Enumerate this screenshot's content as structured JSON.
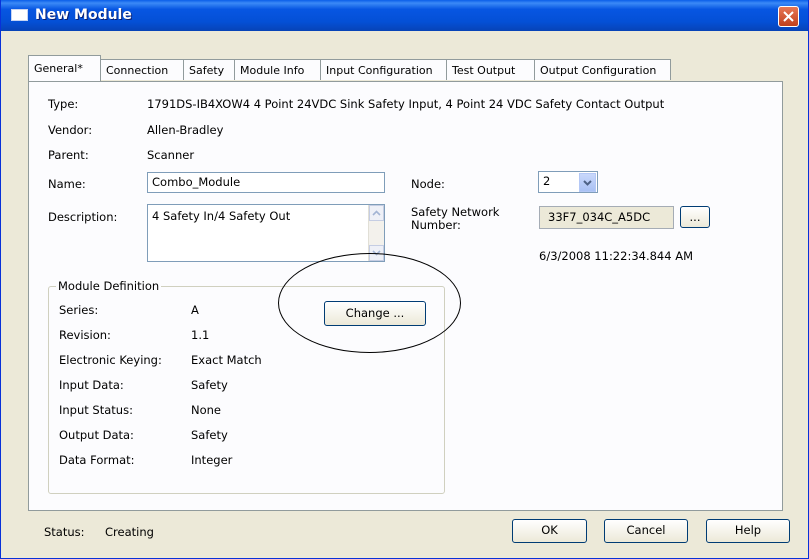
{
  "window": {
    "title": "New Module"
  },
  "tabs": [
    {
      "label": "General*"
    },
    {
      "label": "Connection"
    },
    {
      "label": "Safety"
    },
    {
      "label": "Module Info"
    },
    {
      "label": "Input Configuration"
    },
    {
      "label": "Test Output"
    },
    {
      "label": "Output Configuration"
    }
  ],
  "general": {
    "type_label": "Type:",
    "type_value": "1791DS-IB4XOW4 4 Point 24VDC Sink Safety Input, 4 Point 24 VDC Safety Contact Output",
    "vendor_label": "Vendor:",
    "vendor_value": "Allen-Bradley",
    "parent_label": "Parent:",
    "parent_value": "Scanner",
    "name_label": "Name:",
    "name_value": "Combo_Module",
    "description_label": "Description:",
    "description_value": "4 Safety In/4 Safety Out",
    "node_label": "Node:",
    "node_value": "2",
    "safety_network_label_line1": "Safety Network",
    "safety_network_label_line2": "Number:",
    "safety_network_value": "33F7_034C_A5DC",
    "safety_network_button": "...",
    "timestamp": "6/3/2008 11:22:34.844 AM"
  },
  "module_definition": {
    "legend": "Module Definition",
    "change_button": "Change ...",
    "rows": [
      {
        "label": "Series:",
        "value": "A"
      },
      {
        "label": "Revision:",
        "value": "1.1"
      },
      {
        "label": "Electronic Keying:",
        "value": "Exact Match"
      },
      {
        "label": "Input Data:",
        "value": "Safety"
      },
      {
        "label": "Input Status:",
        "value": "None"
      },
      {
        "label": "Output Data:",
        "value": "Safety"
      },
      {
        "label": "Data Format:",
        "value": "Integer"
      }
    ]
  },
  "footer": {
    "status_label": "Status:",
    "status_value": "Creating",
    "ok_button": "OK",
    "cancel_button": "Cancel",
    "help_button": "Help"
  },
  "icons": {
    "window_icon": "module-window-icon",
    "close": "close-icon",
    "scroll_up": "scroll-up-arrow-icon",
    "scroll_down": "scroll-down-arrow-icon",
    "dropdown": "chevron-down-icon"
  },
  "colors": {
    "titlebar": "#0756e2",
    "close_button": "#d5552f",
    "dialog_bg": "#ece9d8",
    "panel_bg": "#fcfcfe"
  }
}
